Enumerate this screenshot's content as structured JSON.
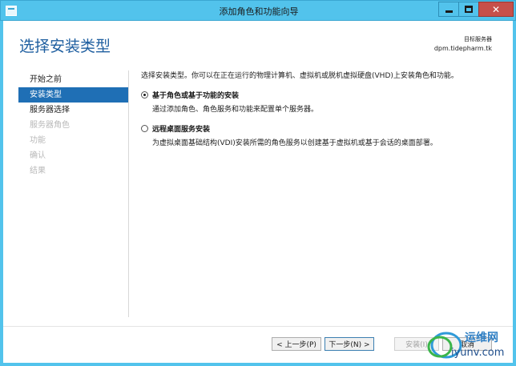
{
  "window": {
    "title": "添加角色和功能向导",
    "close_glyph": "✕"
  },
  "header": {
    "page_title": "选择安装类型",
    "target_label": "目标服务器",
    "target_value": "dpm.tidepharm.tk"
  },
  "nav": {
    "items": [
      {
        "label": "开始之前",
        "state": "normal"
      },
      {
        "label": "安装类型",
        "state": "selected"
      },
      {
        "label": "服务器选择",
        "state": "normal"
      },
      {
        "label": "服务器角色",
        "state": "disabled"
      },
      {
        "label": "功能",
        "state": "disabled"
      },
      {
        "label": "确认",
        "state": "disabled"
      },
      {
        "label": "结果",
        "state": "disabled"
      }
    ]
  },
  "main": {
    "description": "选择安装类型。你可以在正在运行的物理计算机、虚拟机或脱机虚拟硬盘(VHD)上安装角色和功能。",
    "options": [
      {
        "title": "基于角色或基于功能的安装",
        "description": "通过添加角色、角色服务和功能来配置单个服务器。",
        "selected": true
      },
      {
        "title": "远程桌面服务安装",
        "description": "为虚拟桌面基础结构(VDI)安装所需的角色服务以创建基于虚拟机或基于会话的桌面部署。",
        "selected": false
      }
    ]
  },
  "footer": {
    "prev_label": "< 上一步(P)",
    "next_label": "下一步(N) >",
    "install_label": "安装(I)",
    "cancel_label": "取消"
  },
  "watermark": {
    "brand": "运维网",
    "domain": "iyunv.com"
  },
  "colors": {
    "titlebar": "#52c3ec",
    "accent": "#1f6fb5",
    "page_title": "#1f5fa0",
    "close_button": "#c7504a"
  }
}
